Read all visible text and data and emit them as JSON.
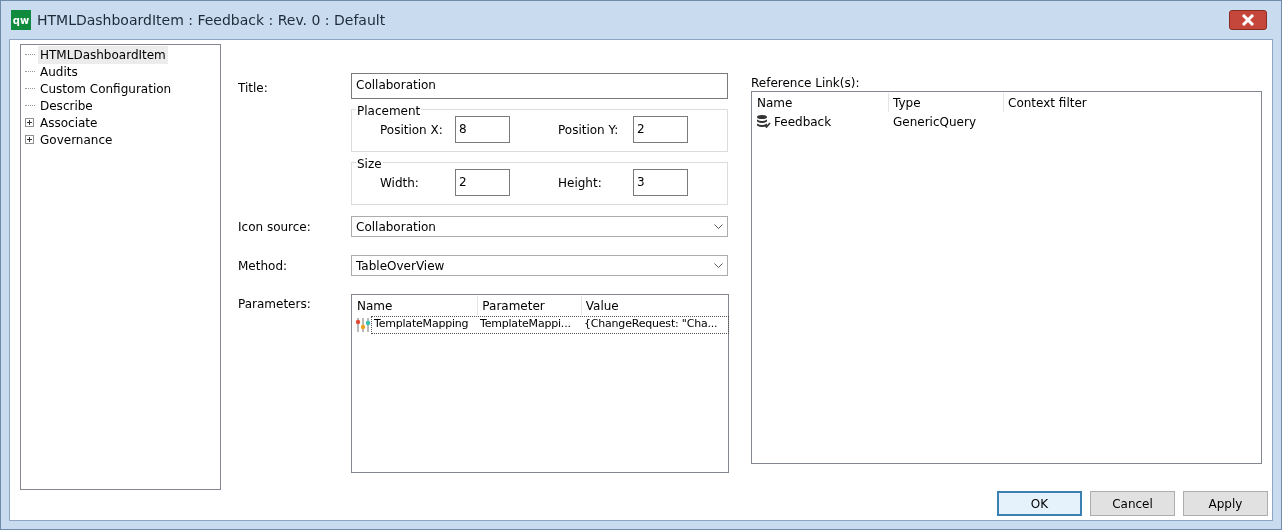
{
  "window": {
    "title": "HTMLDashboardItem : Feedback : Rev. 0  : Default",
    "logo": "qw"
  },
  "tree": [
    {
      "label": "HTMLDashboardItem",
      "selected": true,
      "expandable": false
    },
    {
      "label": "Audits",
      "selected": false,
      "expandable": false
    },
    {
      "label": "Custom Configuration",
      "selected": false,
      "expandable": false
    },
    {
      "label": "Describe",
      "selected": false,
      "expandable": false
    },
    {
      "label": "Associate",
      "selected": false,
      "expandable": true
    },
    {
      "label": "Governance",
      "selected": false,
      "expandable": true
    }
  ],
  "form": {
    "title_label": "Title:",
    "title_value": "Collaboration",
    "placement": {
      "legend": "Placement",
      "fields": [
        {
          "label": "Position X:",
          "value": "8"
        },
        {
          "label": "Position Y:",
          "value": "2"
        }
      ]
    },
    "size": {
      "legend": "Size",
      "fields": [
        {
          "label": "Width:",
          "value": "2"
        },
        {
          "label": "Height:",
          "value": "3"
        }
      ]
    },
    "icon_source_label": "Icon source:",
    "icon_source_value": "Collaboration",
    "method_label": "Method:",
    "method_value": "TableOverView",
    "parameters_label": "Parameters:",
    "parameters": {
      "columns": [
        "Name",
        "Parameter",
        "Value"
      ],
      "rows": [
        {
          "cells": [
            "TemplateMapping",
            "TemplateMappi...",
            "{ChangeRequest: \"Cha..."
          ],
          "focused": true
        }
      ]
    }
  },
  "references": {
    "label": "Reference Link(s):",
    "columns": [
      "Name",
      "Type",
      "Context filter"
    ],
    "rows": [
      {
        "cells": [
          "Feedback",
          "GenericQuery",
          ""
        ]
      }
    ]
  },
  "buttons": [
    {
      "label": "OK",
      "default": true
    },
    {
      "label": "Cancel",
      "default": false
    },
    {
      "label": "Apply",
      "default": false
    }
  ]
}
